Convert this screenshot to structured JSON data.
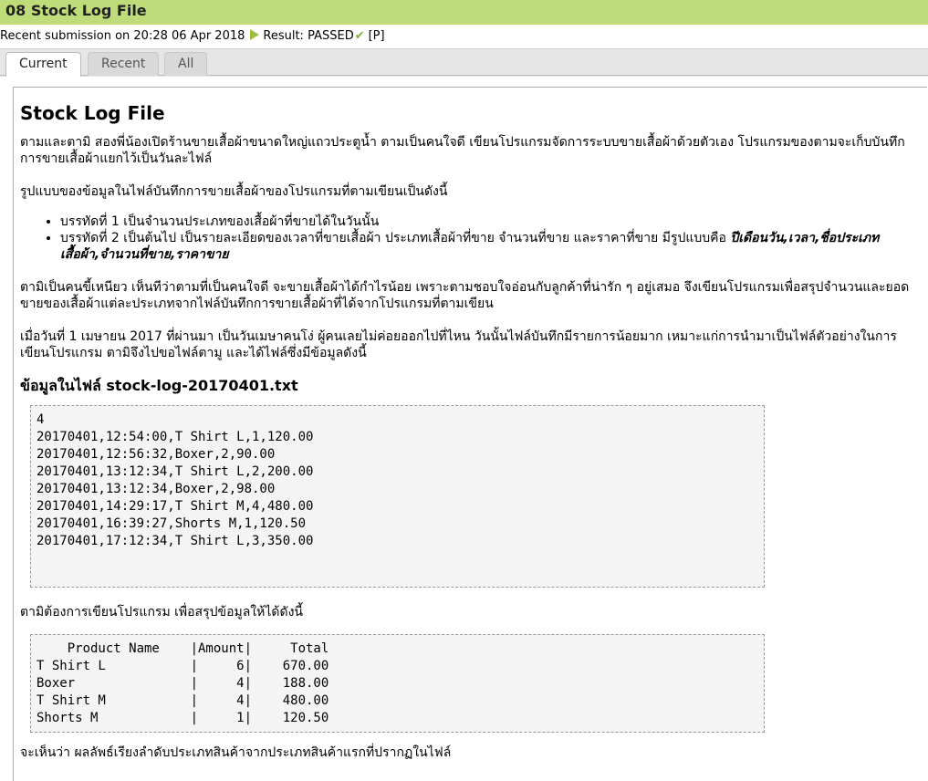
{
  "header": {
    "title": "08 Stock Log File"
  },
  "submission": {
    "text": "Recent submission on 20:28 06 Apr 2018",
    "result": "Result: PASSED",
    "code": "[P]"
  },
  "tabs": [
    {
      "label": "Current",
      "active": true
    },
    {
      "label": "Recent",
      "active": false
    },
    {
      "label": "All",
      "active": false
    }
  ],
  "doc": {
    "title": "Stock Log File",
    "intro": "ตามและตามิ สองพี่น้องเปิดร้านขายเสื้อผ้าขนาดใหญ่แถวประตูน้ำ ตามเป็นคนใจดี เขียนโปรแกรมจัดการระบบขายเสื้อผ้าด้วยตัวเอง โปรแกรมของตามจะเก็บบันทึกการขายเสื้อผ้าแยกไว้เป็นวันละไฟล์",
    "format_intro": "รูปแบบของข้อมูลในไฟล์บันทึกการขายเสื้อผ้าของโปรแกรมที่ตามเขียนเป็นดังนี้",
    "bullet1": "บรรทัดที่ 1 เป็นจำนวนประเภทของเสื้อผ้าที่ขายได้ในวันนั้น",
    "bullet2": "บรรทัดที่ 2 เป็นต้นไป เป็นรายละเอียดของเวลาที่ขายเสื้อผ้า ประเภทเสื้อผ้าที่ขาย จำนวนที่ขาย และราคาที่ขาย มีรูปแบบคือ ",
    "bullet2_format": "ปีเดือนวัน,เวลา,ชื่อประเภทเสื้อผ้า,จำนวนที่ขาย,ราคาขาย",
    "para3": "ตามิเป็นคนขี้เหนียว เห็นทีว่าตามที่เป็นคนใจดี จะขายเสื้อผ้าได้กำไรน้อย เพราะตามชอบใจอ่อนกับลูกค้าที่น่ารัก ๆ อยู่เสมอ จึงเขียนโปรแกรมเพื่อสรุปจำนวนและยอดขายของเสื้อผ้าแต่ละประเภทจากไฟล์บันทึกการขายเสื้อผ้าที่ได้จากโปรแกรมที่ตามเขียน",
    "para4": "เมื่อวันที่ 1 เมษายน 2017 ที่ผ่านมา เป็นวันเมษาคนโง่ ผู้คนเลยไม่ค่อยออกไปที่ไหน วันนั้นไฟล์บันทึกมีรายการน้อยมาก เหมาะแก่การนำมาเป็นไฟล์ตัวอย่างในการเขียนโปรแกรม ตามิจึงไปขอไฟล์ตามู และได้ไฟล์ซึ่งมีข้อมูลดังนี้",
    "file_heading": "ข้อมูลในไฟล์ stock-log-20170401.txt",
    "file_content": "4\n20170401,12:54:00,T Shirt L,1,120.00\n20170401,12:56:32,Boxer,2,90.00\n20170401,13:12:34,T Shirt L,2,200.00\n20170401,13:12:34,Boxer,2,98.00\n20170401,14:29:17,T Shirt M,4,480.00\n20170401,16:39:27,Shorts M,1,120.50\n20170401,17:12:34,T Shirt L,3,350.00",
    "para5": "ตามิต้องการเขียนโปรแกรม เพื่อสรุปข้อมูลให้ได้ดังนี้",
    "summary_table": "    Product Name    |Amount|     Total\nT Shirt L           |     6|    670.00\nBoxer               |     4|    188.00\nT Shirt M           |     4|    480.00\nShorts M            |     1|    120.50",
    "para6": "จะเห็นว่า ผลลัพธ์เรียงลำดับประเภทสินค้าจากประเภทสินค้าแรกที่ปรากฏในไฟล์"
  }
}
